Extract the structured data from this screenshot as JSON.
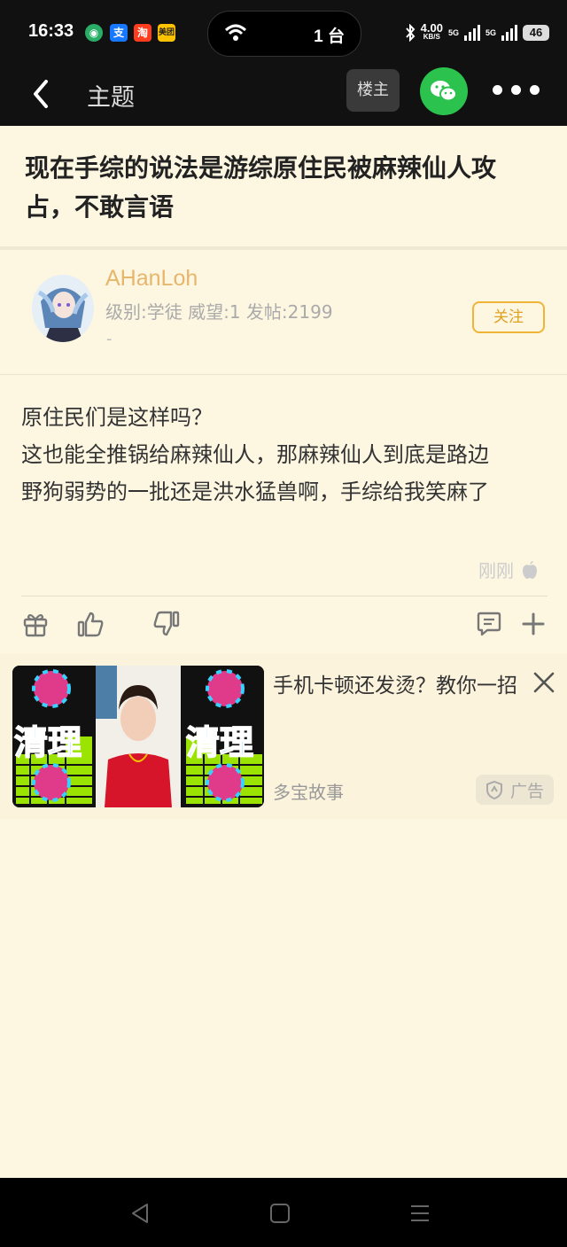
{
  "status_bar": {
    "time": "16:33",
    "apps": [
      {
        "icon": "wechat-icon",
        "color": "#2aae67",
        "glyph": "◉"
      },
      {
        "icon": "alipay-icon",
        "color": "#1677ff",
        "glyph": "支"
      },
      {
        "icon": "taobao-icon",
        "color": "#ff3c1e",
        "glyph": "淘"
      },
      {
        "icon": "meituan-icon",
        "color": "#ffc300",
        "glyph": "美团"
      }
    ],
    "island_text": "1 台",
    "net_speed": "4.00",
    "net_unit": "KB/S",
    "sig1": "5G",
    "sig2": "5G",
    "battery": "46"
  },
  "nav": {
    "title": "主题",
    "op_label": "楼主"
  },
  "post": {
    "title": "现在手综的说法是游综原住民被麻辣仙人攻占，不敢言语",
    "author": {
      "name": "AHanLoh",
      "meta": "级别:学徒 威望:1 发帖:2199",
      "signature": "-",
      "follow_label": "关注"
    },
    "lines": [
      "原住民们是这样吗？",
      "这也能全推锅给麻辣仙人，那麻辣仙人到底是路边",
      "野狗弱势的一批还是洪水猛兽啊，手综给我笑麻了"
    ],
    "time": "刚刚"
  },
  "ad": {
    "title": "手机卡顿还发烫？教你一招",
    "image_text_left": "清理",
    "image_text_right": "清理",
    "source": "多宝故事",
    "badge": "广告"
  },
  "colors": {
    "background": "#fdf7e2",
    "accent": "#f0b436",
    "username": "#e7b66a",
    "wechat_green": "#2bc24e"
  }
}
